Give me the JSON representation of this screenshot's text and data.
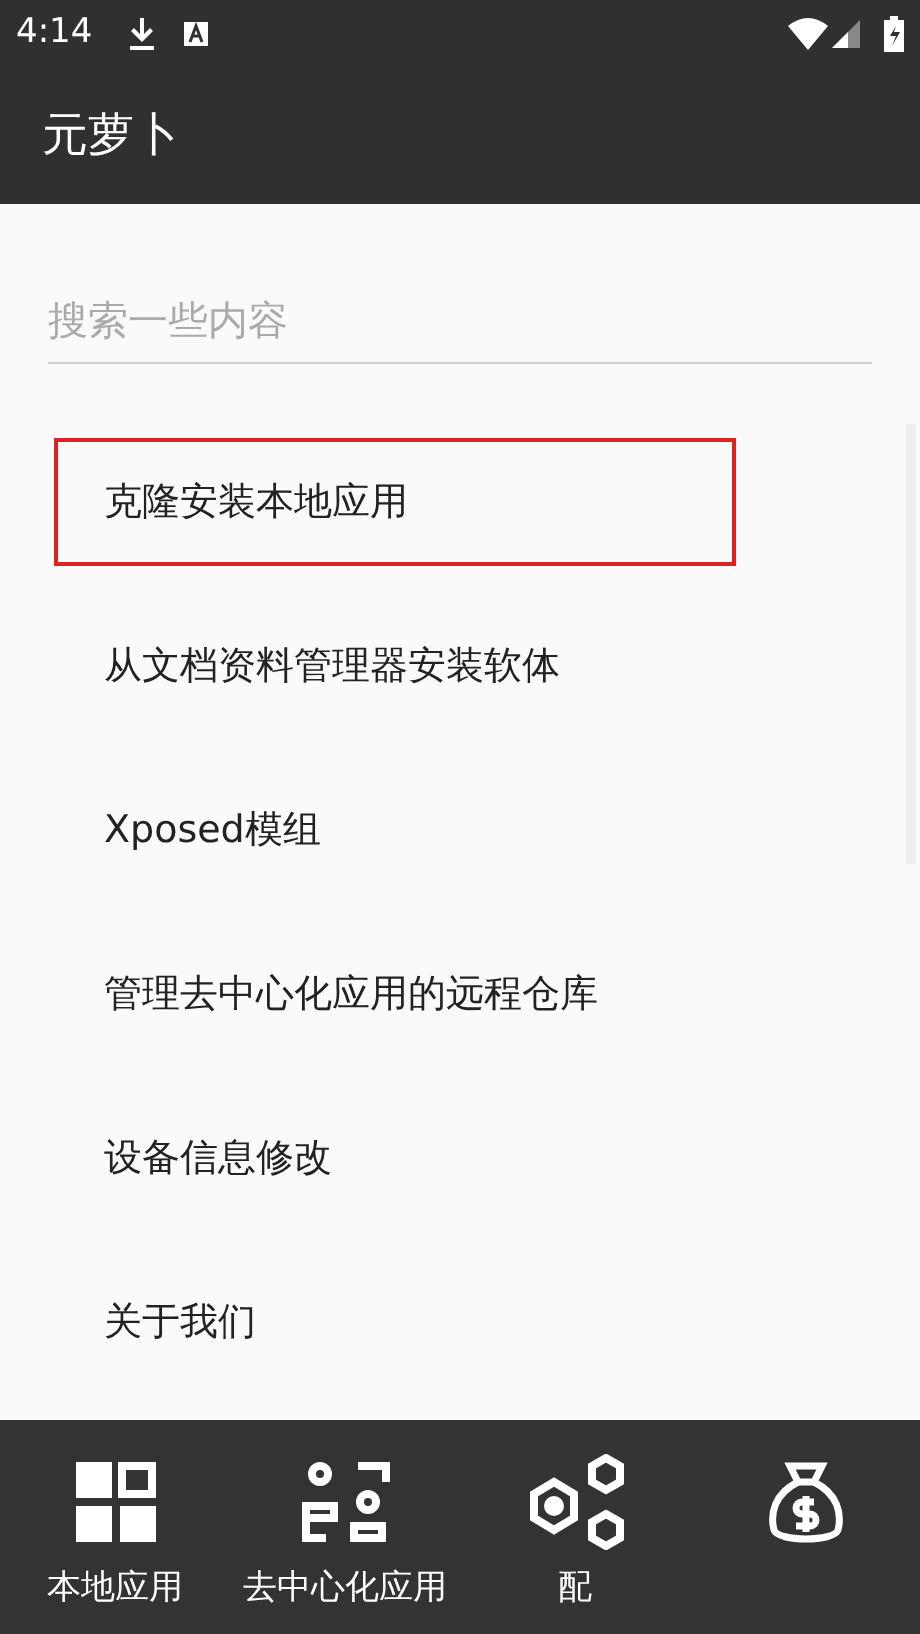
{
  "status_bar": {
    "time": "4:14"
  },
  "app_bar": {
    "title": "元萝卜"
  },
  "search": {
    "placeholder": "搜索一些内容"
  },
  "menu_items": [
    {
      "label": "克隆安装本地应用",
      "highlighted": true
    },
    {
      "label": "从文档资料管理器安装软体",
      "highlighted": false
    },
    {
      "label": "Xposed模组",
      "highlighted": false
    },
    {
      "label": "管理去中心化应用的远程仓库",
      "highlighted": false
    },
    {
      "label": "设备信息修改",
      "highlighted": false
    },
    {
      "label": "关于我们",
      "highlighted": false
    }
  ],
  "bottom_nav": [
    {
      "kind": "grid",
      "label": "本地应用"
    },
    {
      "kind": "people",
      "label": "去中心化应用"
    },
    {
      "kind": "hexagons",
      "label": "配"
    },
    {
      "kind": "moneybag"
    }
  ]
}
